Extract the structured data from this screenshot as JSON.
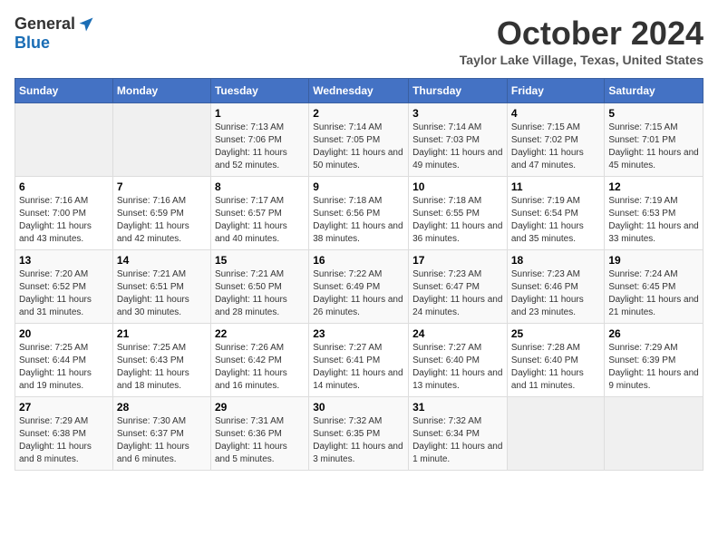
{
  "header": {
    "logo_general": "General",
    "logo_blue": "Blue",
    "month_title": "October 2024",
    "location": "Taylor Lake Village, Texas, United States"
  },
  "days_of_week": [
    "Sunday",
    "Monday",
    "Tuesday",
    "Wednesday",
    "Thursday",
    "Friday",
    "Saturday"
  ],
  "weeks": [
    [
      {
        "day": "",
        "empty": true
      },
      {
        "day": "",
        "empty": true
      },
      {
        "day": "1",
        "sunrise": "Sunrise: 7:13 AM",
        "sunset": "Sunset: 7:06 PM",
        "daylight": "Daylight: 11 hours and 52 minutes."
      },
      {
        "day": "2",
        "sunrise": "Sunrise: 7:14 AM",
        "sunset": "Sunset: 7:05 PM",
        "daylight": "Daylight: 11 hours and 50 minutes."
      },
      {
        "day": "3",
        "sunrise": "Sunrise: 7:14 AM",
        "sunset": "Sunset: 7:03 PM",
        "daylight": "Daylight: 11 hours and 49 minutes."
      },
      {
        "day": "4",
        "sunrise": "Sunrise: 7:15 AM",
        "sunset": "Sunset: 7:02 PM",
        "daylight": "Daylight: 11 hours and 47 minutes."
      },
      {
        "day": "5",
        "sunrise": "Sunrise: 7:15 AM",
        "sunset": "Sunset: 7:01 PM",
        "daylight": "Daylight: 11 hours and 45 minutes."
      }
    ],
    [
      {
        "day": "6",
        "sunrise": "Sunrise: 7:16 AM",
        "sunset": "Sunset: 7:00 PM",
        "daylight": "Daylight: 11 hours and 43 minutes."
      },
      {
        "day": "7",
        "sunrise": "Sunrise: 7:16 AM",
        "sunset": "Sunset: 6:59 PM",
        "daylight": "Daylight: 11 hours and 42 minutes."
      },
      {
        "day": "8",
        "sunrise": "Sunrise: 7:17 AM",
        "sunset": "Sunset: 6:57 PM",
        "daylight": "Daylight: 11 hours and 40 minutes."
      },
      {
        "day": "9",
        "sunrise": "Sunrise: 7:18 AM",
        "sunset": "Sunset: 6:56 PM",
        "daylight": "Daylight: 11 hours and 38 minutes."
      },
      {
        "day": "10",
        "sunrise": "Sunrise: 7:18 AM",
        "sunset": "Sunset: 6:55 PM",
        "daylight": "Daylight: 11 hours and 36 minutes."
      },
      {
        "day": "11",
        "sunrise": "Sunrise: 7:19 AM",
        "sunset": "Sunset: 6:54 PM",
        "daylight": "Daylight: 11 hours and 35 minutes."
      },
      {
        "day": "12",
        "sunrise": "Sunrise: 7:19 AM",
        "sunset": "Sunset: 6:53 PM",
        "daylight": "Daylight: 11 hours and 33 minutes."
      }
    ],
    [
      {
        "day": "13",
        "sunrise": "Sunrise: 7:20 AM",
        "sunset": "Sunset: 6:52 PM",
        "daylight": "Daylight: 11 hours and 31 minutes."
      },
      {
        "day": "14",
        "sunrise": "Sunrise: 7:21 AM",
        "sunset": "Sunset: 6:51 PM",
        "daylight": "Daylight: 11 hours and 30 minutes."
      },
      {
        "day": "15",
        "sunrise": "Sunrise: 7:21 AM",
        "sunset": "Sunset: 6:50 PM",
        "daylight": "Daylight: 11 hours and 28 minutes."
      },
      {
        "day": "16",
        "sunrise": "Sunrise: 7:22 AM",
        "sunset": "Sunset: 6:49 PM",
        "daylight": "Daylight: 11 hours and 26 minutes."
      },
      {
        "day": "17",
        "sunrise": "Sunrise: 7:23 AM",
        "sunset": "Sunset: 6:47 PM",
        "daylight": "Daylight: 11 hours and 24 minutes."
      },
      {
        "day": "18",
        "sunrise": "Sunrise: 7:23 AM",
        "sunset": "Sunset: 6:46 PM",
        "daylight": "Daylight: 11 hours and 23 minutes."
      },
      {
        "day": "19",
        "sunrise": "Sunrise: 7:24 AM",
        "sunset": "Sunset: 6:45 PM",
        "daylight": "Daylight: 11 hours and 21 minutes."
      }
    ],
    [
      {
        "day": "20",
        "sunrise": "Sunrise: 7:25 AM",
        "sunset": "Sunset: 6:44 PM",
        "daylight": "Daylight: 11 hours and 19 minutes."
      },
      {
        "day": "21",
        "sunrise": "Sunrise: 7:25 AM",
        "sunset": "Sunset: 6:43 PM",
        "daylight": "Daylight: 11 hours and 18 minutes."
      },
      {
        "day": "22",
        "sunrise": "Sunrise: 7:26 AM",
        "sunset": "Sunset: 6:42 PM",
        "daylight": "Daylight: 11 hours and 16 minutes."
      },
      {
        "day": "23",
        "sunrise": "Sunrise: 7:27 AM",
        "sunset": "Sunset: 6:41 PM",
        "daylight": "Daylight: 11 hours and 14 minutes."
      },
      {
        "day": "24",
        "sunrise": "Sunrise: 7:27 AM",
        "sunset": "Sunset: 6:40 PM",
        "daylight": "Daylight: 11 hours and 13 minutes."
      },
      {
        "day": "25",
        "sunrise": "Sunrise: 7:28 AM",
        "sunset": "Sunset: 6:40 PM",
        "daylight": "Daylight: 11 hours and 11 minutes."
      },
      {
        "day": "26",
        "sunrise": "Sunrise: 7:29 AM",
        "sunset": "Sunset: 6:39 PM",
        "daylight": "Daylight: 11 hours and 9 minutes."
      }
    ],
    [
      {
        "day": "27",
        "sunrise": "Sunrise: 7:29 AM",
        "sunset": "Sunset: 6:38 PM",
        "daylight": "Daylight: 11 hours and 8 minutes."
      },
      {
        "day": "28",
        "sunrise": "Sunrise: 7:30 AM",
        "sunset": "Sunset: 6:37 PM",
        "daylight": "Daylight: 11 hours and 6 minutes."
      },
      {
        "day": "29",
        "sunrise": "Sunrise: 7:31 AM",
        "sunset": "Sunset: 6:36 PM",
        "daylight": "Daylight: 11 hours and 5 minutes."
      },
      {
        "day": "30",
        "sunrise": "Sunrise: 7:32 AM",
        "sunset": "Sunset: 6:35 PM",
        "daylight": "Daylight: 11 hours and 3 minutes."
      },
      {
        "day": "31",
        "sunrise": "Sunrise: 7:32 AM",
        "sunset": "Sunset: 6:34 PM",
        "daylight": "Daylight: 11 hours and 1 minute."
      },
      {
        "day": "",
        "empty": true
      },
      {
        "day": "",
        "empty": true
      }
    ]
  ]
}
